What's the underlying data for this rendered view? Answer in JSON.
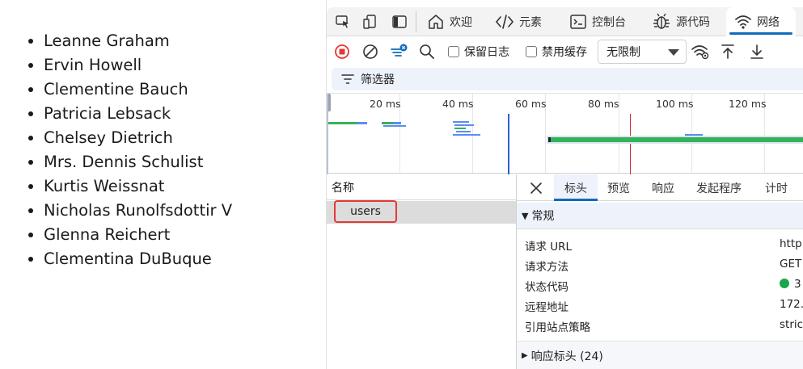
{
  "page": {
    "users": [
      "Leanne Graham",
      "Ervin Howell",
      "Clementine Bauch",
      "Patricia Lebsack",
      "Chelsey Dietrich",
      "Mrs. Dennis Schulist",
      "Kurtis Weissnat",
      "Nicholas Runolfsdottir V",
      "Glenna Reichert",
      "Clementina DuBuque"
    ]
  },
  "devtools": {
    "tabs": {
      "welcome": "欢迎",
      "elements": "元素",
      "console": "控制台",
      "sources": "源代码",
      "network": "网络"
    },
    "toolbar": {
      "preserve_log": "保留日志",
      "disable_cache": "禁用缓存",
      "throttle": "无限制"
    },
    "filter": {
      "label": "筛选器"
    },
    "timeline": {
      "ticks": [
        "20 ms",
        "40 ms",
        "60 ms",
        "80 ms",
        "100 ms",
        "120 ms"
      ]
    },
    "requests": {
      "header": "名称",
      "rows": [
        "users"
      ]
    },
    "details": {
      "tabs": [
        "标头",
        "预览",
        "响应",
        "发起程序",
        "计时"
      ],
      "general_title": "常规",
      "fields": [
        {
          "label": "请求 URL",
          "value": "http"
        },
        {
          "label": "请求方法",
          "value": "GET"
        },
        {
          "label": "状态代码",
          "value": "3"
        },
        {
          "label": "远程地址",
          "value": "172."
        },
        {
          "label": "引用站点策略",
          "value": "stric"
        }
      ],
      "response_headers": "响应标头 (24)"
    },
    "colors": {
      "accent": "#0f6cbd",
      "record": "#e53935",
      "status_ok": "#1aa64b",
      "waterfall": "#34b35a"
    }
  }
}
